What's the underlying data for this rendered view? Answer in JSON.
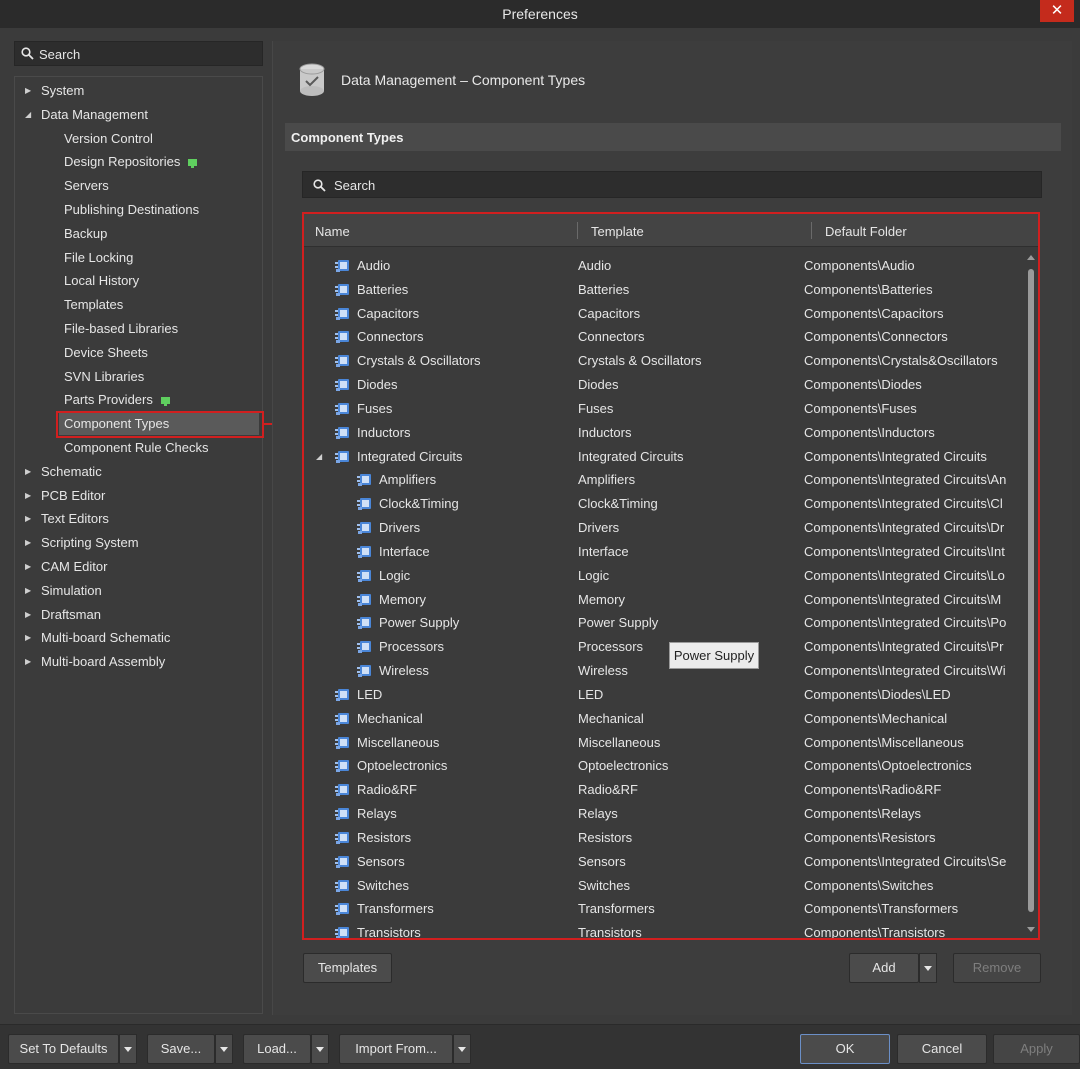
{
  "window": {
    "title": "Preferences"
  },
  "left_search": {
    "placeholder": "Search"
  },
  "tree": [
    {
      "label": "System",
      "expander": "collapsed",
      "level": 0
    },
    {
      "label": "Data Management",
      "expander": "expanded",
      "level": 0
    },
    {
      "label": "Version Control",
      "level": 1
    },
    {
      "label": "Design Repositories",
      "level": 1,
      "badge": "sync-icon"
    },
    {
      "label": "Servers",
      "level": 1
    },
    {
      "label": "Publishing Destinations",
      "level": 1
    },
    {
      "label": "Backup",
      "level": 1
    },
    {
      "label": "File Locking",
      "level": 1
    },
    {
      "label": "Local History",
      "level": 1
    },
    {
      "label": "Templates",
      "level": 1
    },
    {
      "label": "File-based Libraries",
      "level": 1
    },
    {
      "label": "Device Sheets",
      "level": 1
    },
    {
      "label": "SVN Libraries",
      "level": 1
    },
    {
      "label": "Parts Providers",
      "level": 1,
      "badge": "sync-icon"
    },
    {
      "label": "Component Types",
      "level": 1,
      "selected": true
    },
    {
      "label": "Component Rule Checks",
      "level": 1
    },
    {
      "label": "Schematic",
      "expander": "collapsed",
      "level": 0
    },
    {
      "label": "PCB Editor",
      "expander": "collapsed",
      "level": 0
    },
    {
      "label": "Text Editors",
      "expander": "collapsed",
      "level": 0
    },
    {
      "label": "Scripting System",
      "expander": "collapsed",
      "level": 0
    },
    {
      "label": "CAM Editor",
      "expander": "collapsed",
      "level": 0
    },
    {
      "label": "Simulation",
      "expander": "collapsed",
      "level": 0
    },
    {
      "label": "Draftsman",
      "expander": "collapsed",
      "level": 0
    },
    {
      "label": "Multi-board Schematic",
      "expander": "collapsed",
      "level": 0
    },
    {
      "label": "Multi-board Assembly",
      "expander": "collapsed",
      "level": 0
    }
  ],
  "page": {
    "title": "Data Management – Component Types",
    "section": "Component Types"
  },
  "grid_search": {
    "placeholder": "Search"
  },
  "grid": {
    "columns": [
      "Name",
      "Template",
      "Default Folder"
    ],
    "rows": [
      {
        "name": "Audio",
        "template": "Audio",
        "folder": "Components\\Audio",
        "level": 0
      },
      {
        "name": "Batteries",
        "template": "Batteries",
        "folder": "Components\\Batteries",
        "level": 0
      },
      {
        "name": "Capacitors",
        "template": "Capacitors",
        "folder": "Components\\Capacitors",
        "level": 0
      },
      {
        "name": "Connectors",
        "template": "Connectors",
        "folder": "Components\\Connectors",
        "level": 0
      },
      {
        "name": "Crystals & Oscillators",
        "template": "Crystals & Oscillators",
        "folder": "Components\\Crystals&Oscillators",
        "level": 0
      },
      {
        "name": "Diodes",
        "template": "Diodes",
        "folder": "Components\\Diodes",
        "level": 0
      },
      {
        "name": "Fuses",
        "template": "Fuses",
        "folder": "Components\\Fuses",
        "level": 0
      },
      {
        "name": "Inductors",
        "template": "Inductors",
        "folder": "Components\\Inductors",
        "level": 0
      },
      {
        "name": "Integrated Circuits",
        "template": "Integrated Circuits",
        "folder": "Components\\Integrated Circuits",
        "level": 0,
        "expander": "expanded"
      },
      {
        "name": "Amplifiers",
        "template": "Amplifiers",
        "folder": "Components\\Integrated Circuits\\An",
        "level": 1
      },
      {
        "name": "Clock&Timing",
        "template": "Clock&Timing",
        "folder": "Components\\Integrated Circuits\\Cl",
        "level": 1
      },
      {
        "name": "Drivers",
        "template": "Drivers",
        "folder": "Components\\Integrated Circuits\\Dr",
        "level": 1
      },
      {
        "name": "Interface",
        "template": "Interface",
        "folder": "Components\\Integrated Circuits\\Int",
        "level": 1
      },
      {
        "name": "Logic",
        "template": "Logic",
        "folder": "Components\\Integrated Circuits\\Lo",
        "level": 1
      },
      {
        "name": "Memory",
        "template": "Memory",
        "folder": "Components\\Integrated Circuits\\M",
        "level": 1
      },
      {
        "name": "Power Supply",
        "template": "Power Supply",
        "folder": "Components\\Integrated Circuits\\Po",
        "level": 1
      },
      {
        "name": "Processors",
        "template": "Processors",
        "folder": "Components\\Integrated Circuits\\Pr",
        "level": 1
      },
      {
        "name": "Wireless",
        "template": "Wireless",
        "folder": "Components\\Integrated Circuits\\Wi",
        "level": 1
      },
      {
        "name": "LED",
        "template": "LED",
        "folder": "Components\\Diodes\\LED",
        "level": 0
      },
      {
        "name": "Mechanical",
        "template": "Mechanical",
        "folder": "Components\\Mechanical",
        "level": 0
      },
      {
        "name": "Miscellaneous",
        "template": "Miscellaneous",
        "folder": "Components\\Miscellaneous",
        "level": 0
      },
      {
        "name": "Optoelectronics",
        "template": "Optoelectronics",
        "folder": "Components\\Optoelectronics",
        "level": 0
      },
      {
        "name": "Radio&RF",
        "template": "Radio&RF",
        "folder": "Components\\Radio&RF",
        "level": 0
      },
      {
        "name": "Relays",
        "template": "Relays",
        "folder": "Components\\Relays",
        "level": 0
      },
      {
        "name": "Resistors",
        "template": "Resistors",
        "folder": "Components\\Resistors",
        "level": 0
      },
      {
        "name": "Sensors",
        "template": "Sensors",
        "folder": "Components\\Integrated Circuits\\Se",
        "level": 0
      },
      {
        "name": "Switches",
        "template": "Switches",
        "folder": "Components\\Switches",
        "level": 0
      },
      {
        "name": "Transformers",
        "template": "Transformers",
        "folder": "Components\\Transformers",
        "level": 0
      },
      {
        "name": "Transistors",
        "template": "Transistors",
        "folder": "Components\\Transistors",
        "level": 0
      }
    ]
  },
  "tooltip": {
    "text": "Power Supply"
  },
  "buttons": {
    "templates": "Templates",
    "add": "Add",
    "remove": "Remove",
    "set_defaults": "Set To Defaults",
    "save": "Save...",
    "load": "Load...",
    "import_from": "Import From...",
    "ok": "OK",
    "cancel": "Cancel",
    "apply": "Apply"
  },
  "icons": {
    "close": "close-icon",
    "search": "search-icon",
    "page": "database-check-icon",
    "component": "component-icon",
    "sync": "sync-icon"
  },
  "colors": {
    "background": "#3b3b3b",
    "highlight_frame": "#d11f1f",
    "close_button": "#c42b1c",
    "component_icon": "#4a86d8",
    "sync_badge": "#5fcf5f"
  }
}
